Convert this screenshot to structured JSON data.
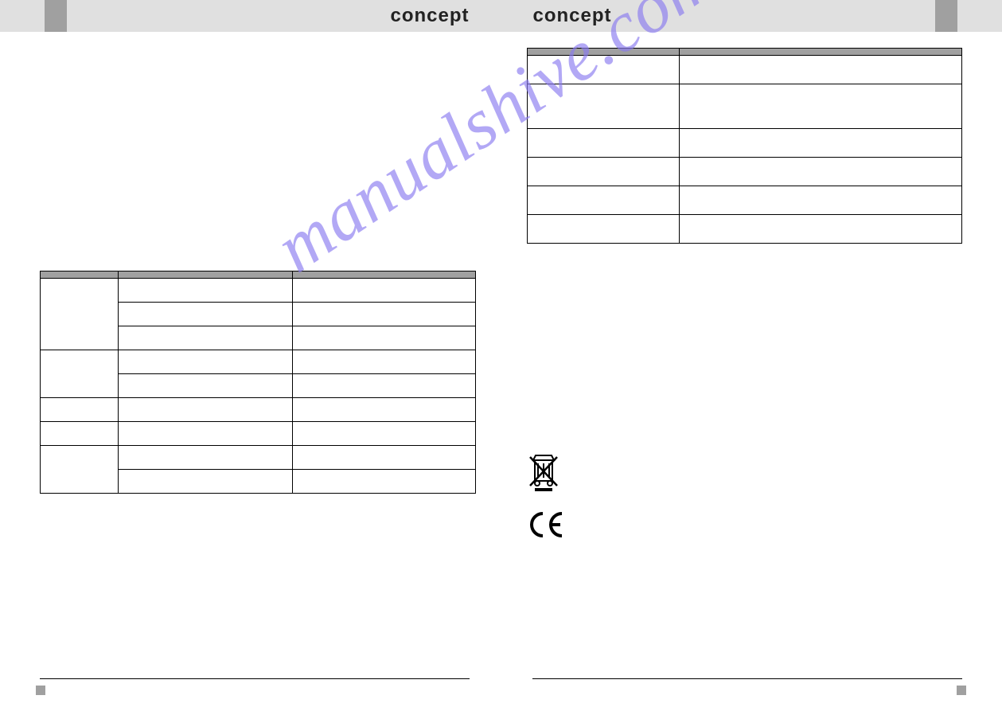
{
  "header": {
    "brand_left": "concept",
    "brand_right": "concept"
  },
  "left_table": {
    "headers": [
      "",
      "",
      ""
    ],
    "rows": [
      {
        "c1": "",
        "c2": "",
        "c3": "",
        "rowspan1": 3
      },
      {
        "c2": "",
        "c3": ""
      },
      {
        "c2": "",
        "c3": ""
      },
      {
        "c1": "",
        "c2": "",
        "c3": "",
        "rowspan1": 2
      },
      {
        "c2": "",
        "c3": ""
      },
      {
        "c1": "",
        "c2": "",
        "c3": ""
      },
      {
        "c1": "",
        "c2": "",
        "c3": ""
      },
      {
        "c1": "",
        "c2": "",
        "c3": "",
        "rowspan1": 2
      },
      {
        "c2": "",
        "c3": ""
      }
    ]
  },
  "right_table": {
    "headers": [
      "",
      ""
    ],
    "rows": [
      [
        "",
        ""
      ],
      [
        "",
        ""
      ],
      [
        "",
        ""
      ],
      [
        "",
        ""
      ],
      [
        "",
        ""
      ],
      [
        "",
        ""
      ]
    ]
  },
  "icons": {
    "weee": "weee-crossed-bin-icon",
    "ce": "ce-mark-icon"
  },
  "watermark": "manualshive.com"
}
